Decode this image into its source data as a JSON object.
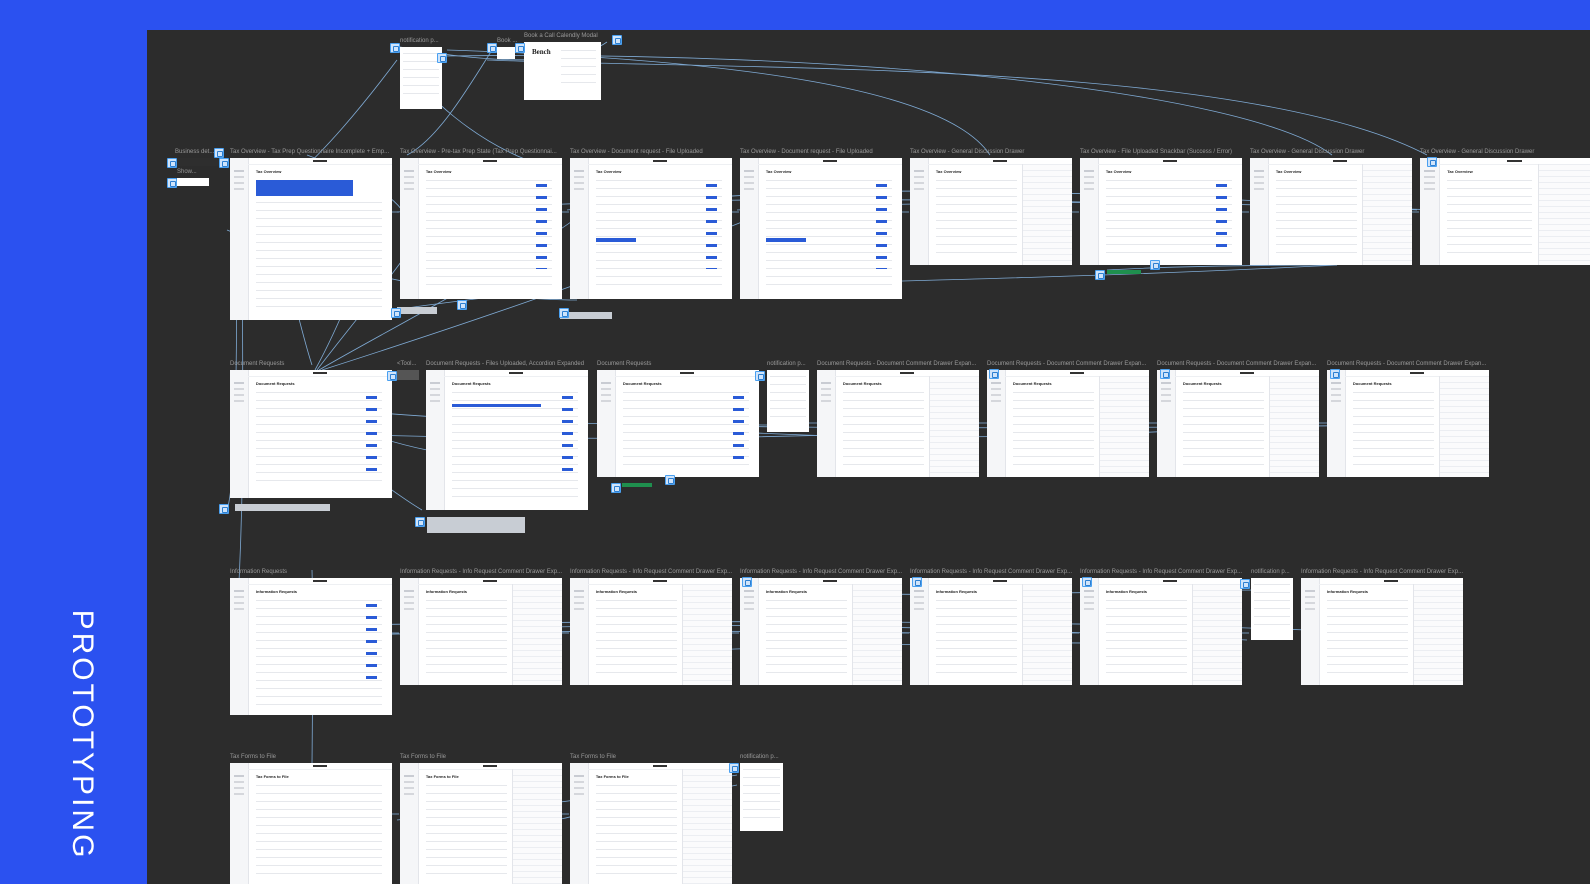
{
  "page": {
    "side_label": "PROTOTYPING",
    "colors": {
      "background": "#2B51F0",
      "canvas": "#2C2C2C",
      "frame": "#FFFFFF",
      "connector": "#8EC1F2",
      "accent": "#2A5BD7"
    }
  },
  "frames": [
    {
      "id": "f-notif-top",
      "title": "notification p...",
      "heading": "",
      "type": "popover"
    },
    {
      "id": "f-book",
      "title": "Book ...",
      "heading": "",
      "type": "small"
    },
    {
      "id": "f-calendly",
      "title": "Book a Call Calendly Modal",
      "heading": "Bench",
      "type": "modal"
    },
    {
      "id": "f-business",
      "title": "Business det...",
      "heading": "",
      "type": "small"
    },
    {
      "id": "f-show",
      "title": "Show...",
      "heading": "",
      "type": "small"
    },
    {
      "id": "f-r1-1",
      "title": "Tax Overview - Tax Prep Questionnaire Incomplete + Emp...",
      "heading": "Tax Overview",
      "type": "page"
    },
    {
      "id": "f-r1-2",
      "title": "Tax Overview - Pre-tax Prep State (Tax Prep Questionnai...",
      "heading": "Tax Overview",
      "type": "page"
    },
    {
      "id": "f-r1-3",
      "title": "Tax Overview - Document request - File Uploaded",
      "heading": "Tax Overview",
      "type": "page"
    },
    {
      "id": "f-r1-4",
      "title": "Tax Overview - Document request - File Uploaded",
      "heading": "Tax Overview",
      "type": "page"
    },
    {
      "id": "f-r1-5",
      "title": "Tax Overview - General Discussion Drawer",
      "heading": "Tax Overview",
      "type": "drawer"
    },
    {
      "id": "f-r1-6",
      "title": "Tax Overview - File Uploaded Snackbar (Success / Error)",
      "heading": "Tax Overview",
      "type": "page"
    },
    {
      "id": "f-r1-7",
      "title": "Tax Overview - General Discussion Drawer",
      "heading": "Tax Overview",
      "type": "drawer"
    },
    {
      "id": "f-r1-8",
      "title": "Tax Overview - General Discussion Drawer",
      "heading": "Tax Overview",
      "type": "drawer"
    },
    {
      "id": "f-r2-1",
      "title": "Document Requests",
      "heading": "Document Requests",
      "type": "list"
    },
    {
      "id": "f-r2-tool",
      "title": "<Tool...",
      "heading": "",
      "type": "small"
    },
    {
      "id": "f-r2-2",
      "title": "Document Requests - Files Uploaded, Accordion Expanded",
      "heading": "Document Requests",
      "type": "list"
    },
    {
      "id": "f-r2-3",
      "title": "Document Requests",
      "heading": "Document Requests",
      "type": "list"
    },
    {
      "id": "f-r2-notif",
      "title": "notification p...",
      "heading": "",
      "type": "popover"
    },
    {
      "id": "f-r2-4",
      "title": "Document Requests - Document Comment Drawer Expan...",
      "heading": "Document Requests",
      "type": "drawer"
    },
    {
      "id": "f-r2-5",
      "title": "Document Requests - Document Comment Drawer Expan...",
      "heading": "Document Requests",
      "type": "drawer"
    },
    {
      "id": "f-r2-6",
      "title": "Document Requests - Document Comment Drawer Expan...",
      "heading": "Document Requests",
      "type": "drawer"
    },
    {
      "id": "f-r2-7",
      "title": "Document Requests - Document Comment Drawer Expan...",
      "heading": "Document Requests",
      "type": "drawer"
    },
    {
      "id": "f-r3-1",
      "title": "Information Requests",
      "heading": "Information Requests",
      "type": "list"
    },
    {
      "id": "f-r3-2",
      "title": "Information Requests - Info Request Comment Drawer Exp...",
      "heading": "Information Requests",
      "type": "drawer"
    },
    {
      "id": "f-r3-3",
      "title": "Information Requests - Info Request Comment Drawer Exp...",
      "heading": "Information Requests",
      "type": "drawer"
    },
    {
      "id": "f-r3-4",
      "title": "Information Requests - Info Request Comment Drawer Exp...",
      "heading": "Information Requests",
      "type": "drawer"
    },
    {
      "id": "f-r3-5",
      "title": "Information Requests - Info Request Comment Drawer Exp...",
      "heading": "Information Requests",
      "type": "drawer"
    },
    {
      "id": "f-r3-6",
      "title": "Information Requests - Info Request Comment Drawer Exp...",
      "heading": "Information Requests",
      "type": "drawer"
    },
    {
      "id": "f-r3-notif",
      "title": "notification p...",
      "heading": "",
      "type": "popover"
    },
    {
      "id": "f-r3-7",
      "title": "Information Requests - Info Request Comment Drawer Exp...",
      "heading": "Information Requests",
      "type": "drawer"
    },
    {
      "id": "f-r4-1",
      "title": "Tax Forms to File",
      "heading": "Tax Forms to File",
      "type": "list"
    },
    {
      "id": "f-r4-2",
      "title": "Tax Forms to File",
      "heading": "Tax Forms to File",
      "type": "drawer"
    },
    {
      "id": "f-r4-3",
      "title": "Tax Forms to File",
      "heading": "Tax Forms to File",
      "type": "drawer"
    },
    {
      "id": "f-r4-notif",
      "title": "notification p...",
      "heading": "",
      "type": "popover"
    }
  ]
}
